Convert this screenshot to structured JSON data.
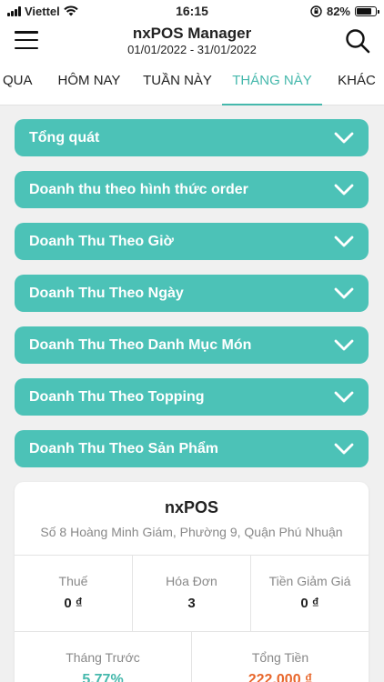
{
  "status_bar": {
    "carrier": "Viettel",
    "time": "16:15",
    "battery": "82%",
    "battery_level": 0.82
  },
  "header": {
    "title": "nxPOS Manager",
    "date_range": "01/01/2022 - 31/01/2022"
  },
  "tabs": [
    {
      "label": "QUA",
      "active": false
    },
    {
      "label": "HÔM NAY",
      "active": false
    },
    {
      "label": "TUẦN NÀY",
      "active": false
    },
    {
      "label": "THÁNG NÀY",
      "active": true
    },
    {
      "label": "KHÁC",
      "active": false
    }
  ],
  "sections": [
    "Tổng quát",
    "Doanh thu theo hình thức order",
    "Doanh Thu Theo Giờ",
    "Doanh Thu Theo Ngày",
    "Doanh Thu Theo Danh Mục Món",
    "Doanh Thu Theo Topping",
    "Doanh Thu Theo Sản Phẩm"
  ],
  "summary": {
    "store_name": "nxPOS",
    "address": "Số 8 Hoàng Minh Giám, Phường 9, Quận Phú Nhuận",
    "tax_label": "Thuế",
    "tax_value": "0 ₫",
    "invoice_label": "Hóa Đơn",
    "invoice_value": "3",
    "discount_label": "Tiền Giảm Giá",
    "discount_value": "0 ₫",
    "prev_month_label": "Tháng Trước",
    "prev_month_value": "5.77%",
    "total_label": "Tổng Tiền",
    "total_value": "222.000 ₫"
  },
  "colors": {
    "accent": "#4cc2b7",
    "tab_active": "#45b8ac",
    "total": "#e8672c"
  }
}
